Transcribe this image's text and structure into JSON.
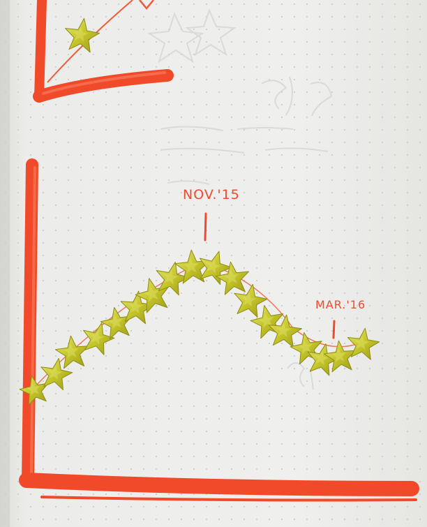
{
  "photo": {
    "subject": "notebook-page-star-sticker-chart"
  },
  "annotations": {
    "nov_label": "NOV.'15",
    "mar_label": "MAR.'16"
  },
  "colors": {
    "page": "#eeeeec",
    "page_edge": "#d4d4d0",
    "dot_grid": "#c9c9c6",
    "marker_red": "#f04a2a",
    "star_gold": "#c9c92a",
    "star_gold_light": "#e3e36a",
    "star_gold_dark": "#8e8c14",
    "faint_ghost_ink": "#d2d2d2"
  },
  "icons": {
    "sticker": "star-sticker-icon"
  }
}
